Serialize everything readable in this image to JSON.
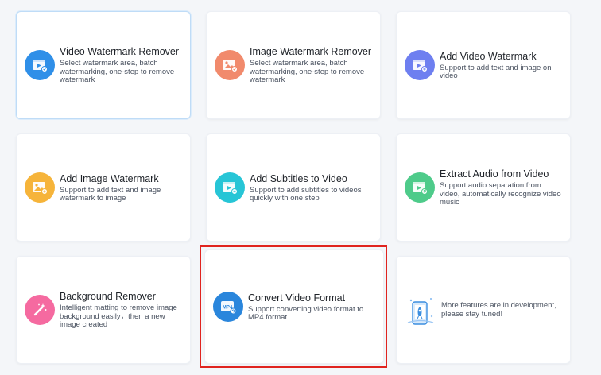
{
  "cards": [
    {
      "title": "Video Watermark Remover",
      "desc": "Select watermark area, batch watermarking, one-step to remove watermark",
      "icon": "video-remove-icon",
      "color": "#2f8fe8"
    },
    {
      "title": "Image Watermark Remover",
      "desc": "Select watermark area, batch watermarking, one-step to remove watermark",
      "icon": "image-remove-icon",
      "color": "#f18a6c"
    },
    {
      "title": "Add Video Watermark",
      "desc": "Support to add text and image on video",
      "icon": "video-add-icon",
      "color": "#6e7ff0"
    },
    {
      "title": "Add Image Watermark",
      "desc": "Support to add text and image watermark to image",
      "icon": "image-add-icon",
      "color": "#f6b43a"
    },
    {
      "title": "Add Subtitles to Video",
      "desc": "Support to add subtitles to videos quickly with one step",
      "icon": "subtitle-icon",
      "color": "#27c5d6"
    },
    {
      "title": "Extract Audio from Video",
      "desc": "Support audio separation from video, automatically recognize video music",
      "icon": "audio-extract-icon",
      "color": "#4ecb8a"
    },
    {
      "title": "Background Remover",
      "desc": "Intelligent matting to remove image background easily，then a new image created",
      "icon": "magic-wand-icon",
      "color": "#f56aa0"
    },
    {
      "title": "Convert Video Format",
      "desc": "Support converting video format to MP4 format",
      "icon": "mp4-convert-icon",
      "color": "#2a86dc",
      "icon_label": "MP4"
    }
  ],
  "dev_notice": "More features are in development, please stay tuned!"
}
